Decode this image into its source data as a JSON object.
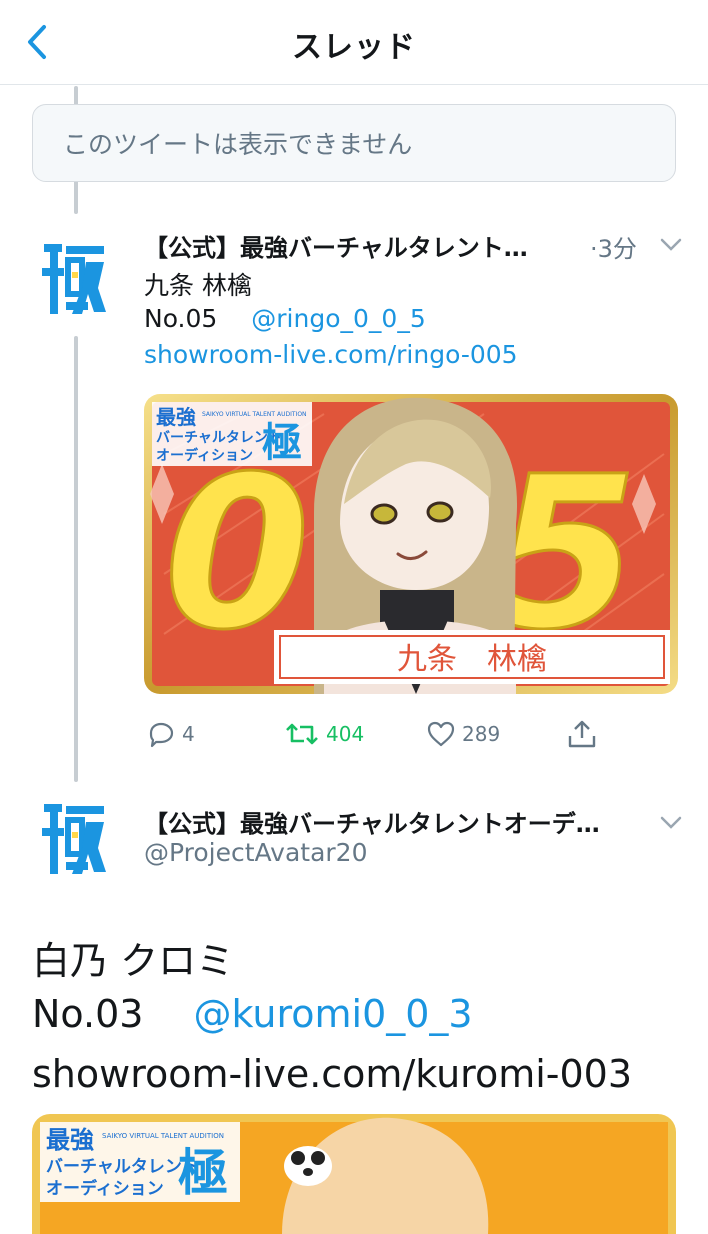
{
  "header": {
    "title": "スレッド",
    "back_icon": "chevron-left-icon"
  },
  "unavailable_tweet": {
    "text": "このツイートは表示できません"
  },
  "tweet1": {
    "name": "【公式】最強バーチャルタレント…",
    "time": "·3分",
    "line1": "九条 林檎",
    "number": "No.05",
    "mention": "@ringo_0_0_5",
    "link": "showroom-live.com/ringo-005",
    "card": {
      "logo_top": "最強",
      "logo_small": "SAIKYO VIRTUAL TALENT AUDITION",
      "logo_mid": "バーチャルタレント",
      "logo_bottom": "オーディション",
      "logo_kanji": "極",
      "big_number": "05",
      "name_plate": "九条　林檎"
    },
    "actions": {
      "replies": "4",
      "retweets": "404",
      "likes": "289"
    }
  },
  "tweet2": {
    "name": "【公式】最強バーチャルタレントオーデ…",
    "handle": "@ProjectAvatar20",
    "line1": "白乃 クロミ",
    "number": "No.03",
    "mention": "@kuromi0_0_3",
    "link": "showroom-live.com/kuromi-003",
    "card": {
      "logo_top": "最強",
      "logo_small": "SAIKYO VIRTUAL TALENT AUDITION",
      "logo_mid": "バーチャルタレント",
      "logo_bottom": "オーディション",
      "logo_kanji": "極"
    }
  },
  "colors": {
    "accent": "#1b95e0",
    "retweet": "#17bf63",
    "muted": "#657786",
    "card_orange": "#e0553a",
    "card_yellow": "#ffe34d"
  }
}
